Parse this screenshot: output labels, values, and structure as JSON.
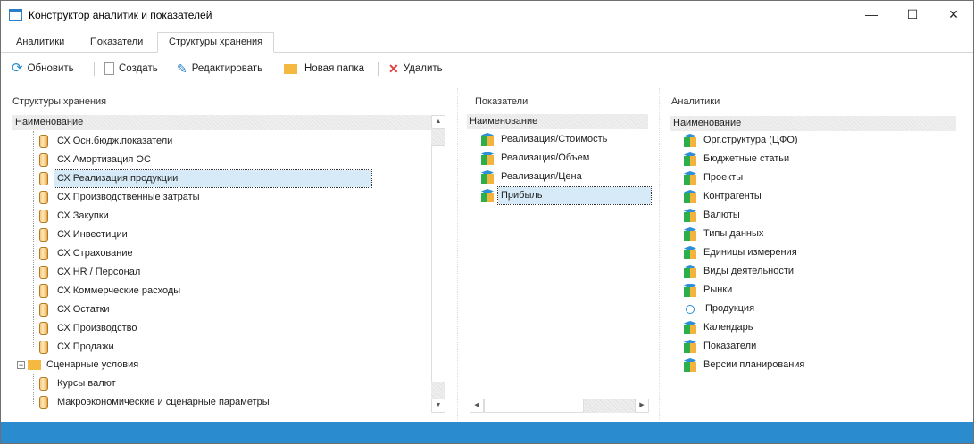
{
  "window": {
    "title": "Конструктор аналитик и показателей",
    "minimize": "—",
    "maximize": "☐",
    "close": "✕"
  },
  "tabs": [
    {
      "label": "Аналитики"
    },
    {
      "label": "Показатели"
    },
    {
      "label": "Структуры хранения"
    }
  ],
  "toolbar": {
    "refresh": "Обновить",
    "create": "Создать",
    "edit": "Редактировать",
    "new_folder": "Новая папка",
    "delete": "Удалить"
  },
  "storage": {
    "title": "Структуры хранения",
    "column": "Наименование",
    "items": [
      "СХ Осн.бюдж.показатели",
      "СХ Амортизация ОС",
      "СХ Реализация продукции",
      "СХ Производственные затраты",
      "СХ Закупки",
      "СХ Инвестиции",
      "СХ Страхование",
      "СХ HR / Персонал",
      "СХ Коммерческие расходы",
      "СХ Остатки",
      "СХ Производство",
      "СХ Продажи"
    ],
    "selected": 2,
    "folder": {
      "label": "Сценарные условия",
      "children": [
        "Курсы валют",
        "Макроэкономические и сценарные параметры"
      ]
    }
  },
  "indicators": {
    "title": "Показатели",
    "column": "Наименование",
    "items": [
      "Реализация/Стоимость",
      "Реализация/Объем",
      "Реализация/Цена",
      "Прибыль"
    ],
    "selected": 3
  },
  "analytics": {
    "title": "Аналитики",
    "column": "Наименование",
    "items": [
      "Орг.структура (ЦФО)",
      "Бюджетные статьи",
      "Проекты",
      "Контрагенты",
      "Валюты",
      "Типы данных",
      "Единицы измерения",
      "Виды деятельности",
      "Рынки",
      "Продукция",
      "Календарь",
      "Показатели",
      "Версии планирования"
    ],
    "circle_item": 9
  },
  "colors": {
    "status_bar": "#2a8bcf",
    "selection": "#d6ebf7"
  }
}
